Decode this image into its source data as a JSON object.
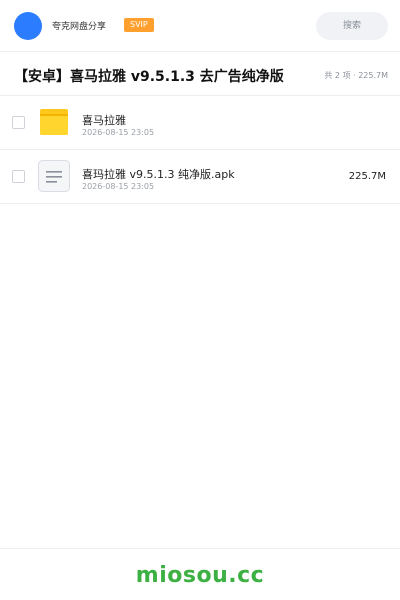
{
  "header": {
    "app_name": "夸克网盘分享",
    "badge": "SVIP",
    "search_placeholder": "搜索",
    "avatar_color": "#2b7cff",
    "badge_color": "#ff9f2d"
  },
  "share": {
    "title": "【安卓】喜马拉雅 v9.5.1.3 去广告纯净版",
    "summary": "共 2 项 · 225.7M"
  },
  "files": [
    {
      "type": "folder",
      "icon": "folder-icon",
      "name": "喜马拉雅",
      "date": "2026-08-15 23:05",
      "size": ""
    },
    {
      "type": "file",
      "icon": "document-icon",
      "name": "喜玛拉雅 v9.5.1.3 纯净版.apk",
      "date": "2026-08-15 23:05",
      "size": "225.7M"
    }
  ],
  "footer": {
    "brand": "miosou.cc",
    "brand_color": "#3cb043"
  }
}
